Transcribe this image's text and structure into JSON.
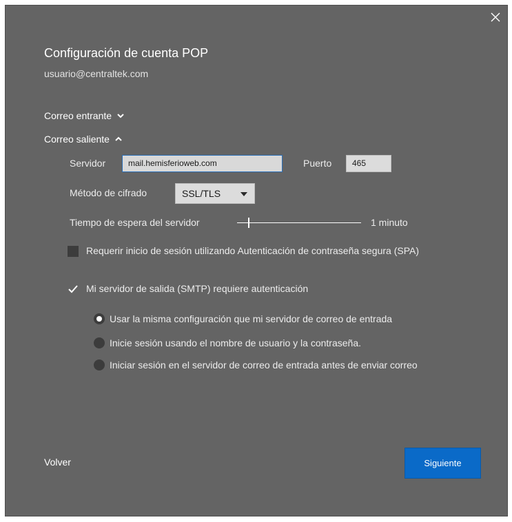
{
  "dialog": {
    "title": "Configuración de cuenta POP",
    "account_email": "usuario@centraltek.com",
    "close_icon": "close-icon"
  },
  "sections": {
    "incoming_label": "Correo entrante",
    "incoming_expanded": false,
    "outgoing_label": "Correo saliente",
    "outgoing_expanded": true
  },
  "outgoing": {
    "server_label": "Servidor",
    "server_value": "mail.hemisferioweb.com",
    "port_label": "Puerto",
    "port_value": "465",
    "encryption_label": "Método de cifrado",
    "encryption_value": "SSL/TLS",
    "timeout_label": "Tiempo de espera del servidor",
    "timeout_value": "1 minuto",
    "spa_label": "Requerir inicio de sesión utilizando Autenticación de contraseña segura (SPA)",
    "spa_checked": false,
    "smtp_auth_label": "Mi servidor de salida (SMTP) requiere autenticación",
    "smtp_auth_checked": true,
    "auth_options": [
      {
        "label": "Usar la misma configuración que mi servidor de correo de entrada",
        "selected": true
      },
      {
        "label": "Inicie sesión usando el nombre de usuario y la contraseña.",
        "selected": false
      },
      {
        "label": "Iniciar sesión en el servidor de correo de entrada antes de enviar correo",
        "selected": false
      }
    ]
  },
  "footer": {
    "back_label": "Volver",
    "next_label": "Siguiente"
  },
  "colors": {
    "dialog_background": "#646464",
    "primary_button": "#0a6ac8",
    "input_focus_border": "#2b6fb8"
  }
}
